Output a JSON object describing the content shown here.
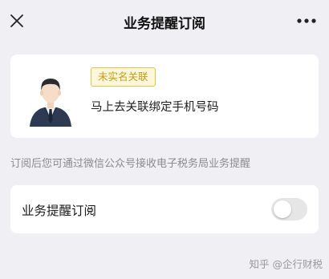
{
  "header": {
    "title": "业务提醒订阅",
    "close_icon": "close-icon",
    "more_icon": "more-icon"
  },
  "user_card": {
    "badge": "未实名关联",
    "bind_text": "马上去关联绑定手机号码",
    "avatar_icon": "user-avatar-icon"
  },
  "hint": "订阅后您可通过微信公众号接收电子税务局业务提醒",
  "subscription": {
    "label": "业务提醒订阅",
    "enabled": false
  },
  "watermark": "知乎 @企行财税",
  "colors": {
    "background": "#efeff4",
    "card": "#ffffff",
    "badge_border": "#e8c34a",
    "badge_text": "#c99a12",
    "toggle_off": "#e6e6e6",
    "hint_text": "#8c8c8c"
  }
}
